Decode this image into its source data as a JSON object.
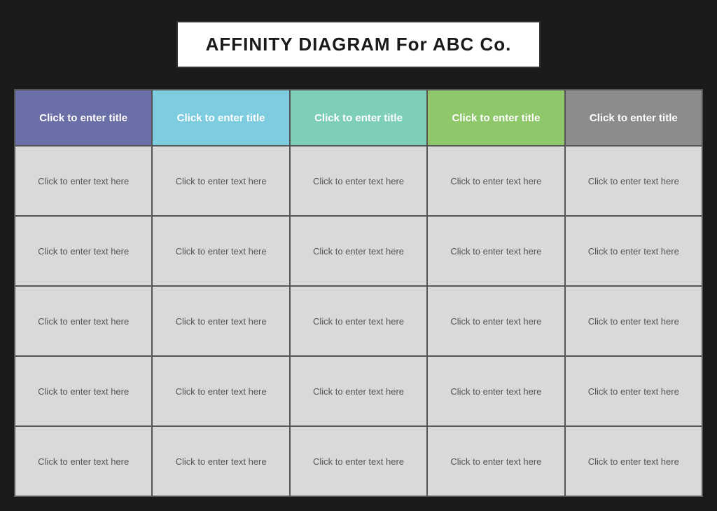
{
  "title": "AFFINITY DIAGRAM For ABC Co.",
  "columns": [
    {
      "id": "col-1",
      "header": "Click to enter title",
      "color": "#6b6fa8",
      "cells": [
        "Click to enter text here",
        "Click to enter text here",
        "Click to enter text here",
        "Click to enter text here",
        "Click to enter text here"
      ]
    },
    {
      "id": "col-2",
      "header": "Click to enter title",
      "color": "#7ecce0",
      "cells": [
        "Click to enter text here",
        "Click to enter text here",
        "Click to enter text here",
        "Click to enter text here",
        "Click to enter text here"
      ]
    },
    {
      "id": "col-3",
      "header": "Click to enter title",
      "color": "#7ecfb8",
      "cells": [
        "Click to enter text here",
        "Click to enter text here",
        "Click to enter text here",
        "Click to enter text here",
        "Click to enter text here"
      ]
    },
    {
      "id": "col-4",
      "header": "Click to enter title",
      "color": "#8ec86a",
      "cells": [
        "Click to enter text here",
        "Click to enter text here",
        "Click to enter text here",
        "Click to enter text here",
        "Click to enter text here"
      ]
    },
    {
      "id": "col-5",
      "header": "Click to enter title",
      "color": "#8c8c8c",
      "cells": [
        "Click to enter text here",
        "Click to enter text here",
        "Click to enter text here",
        "Click to enter text here",
        "Click to enter text here"
      ]
    }
  ]
}
